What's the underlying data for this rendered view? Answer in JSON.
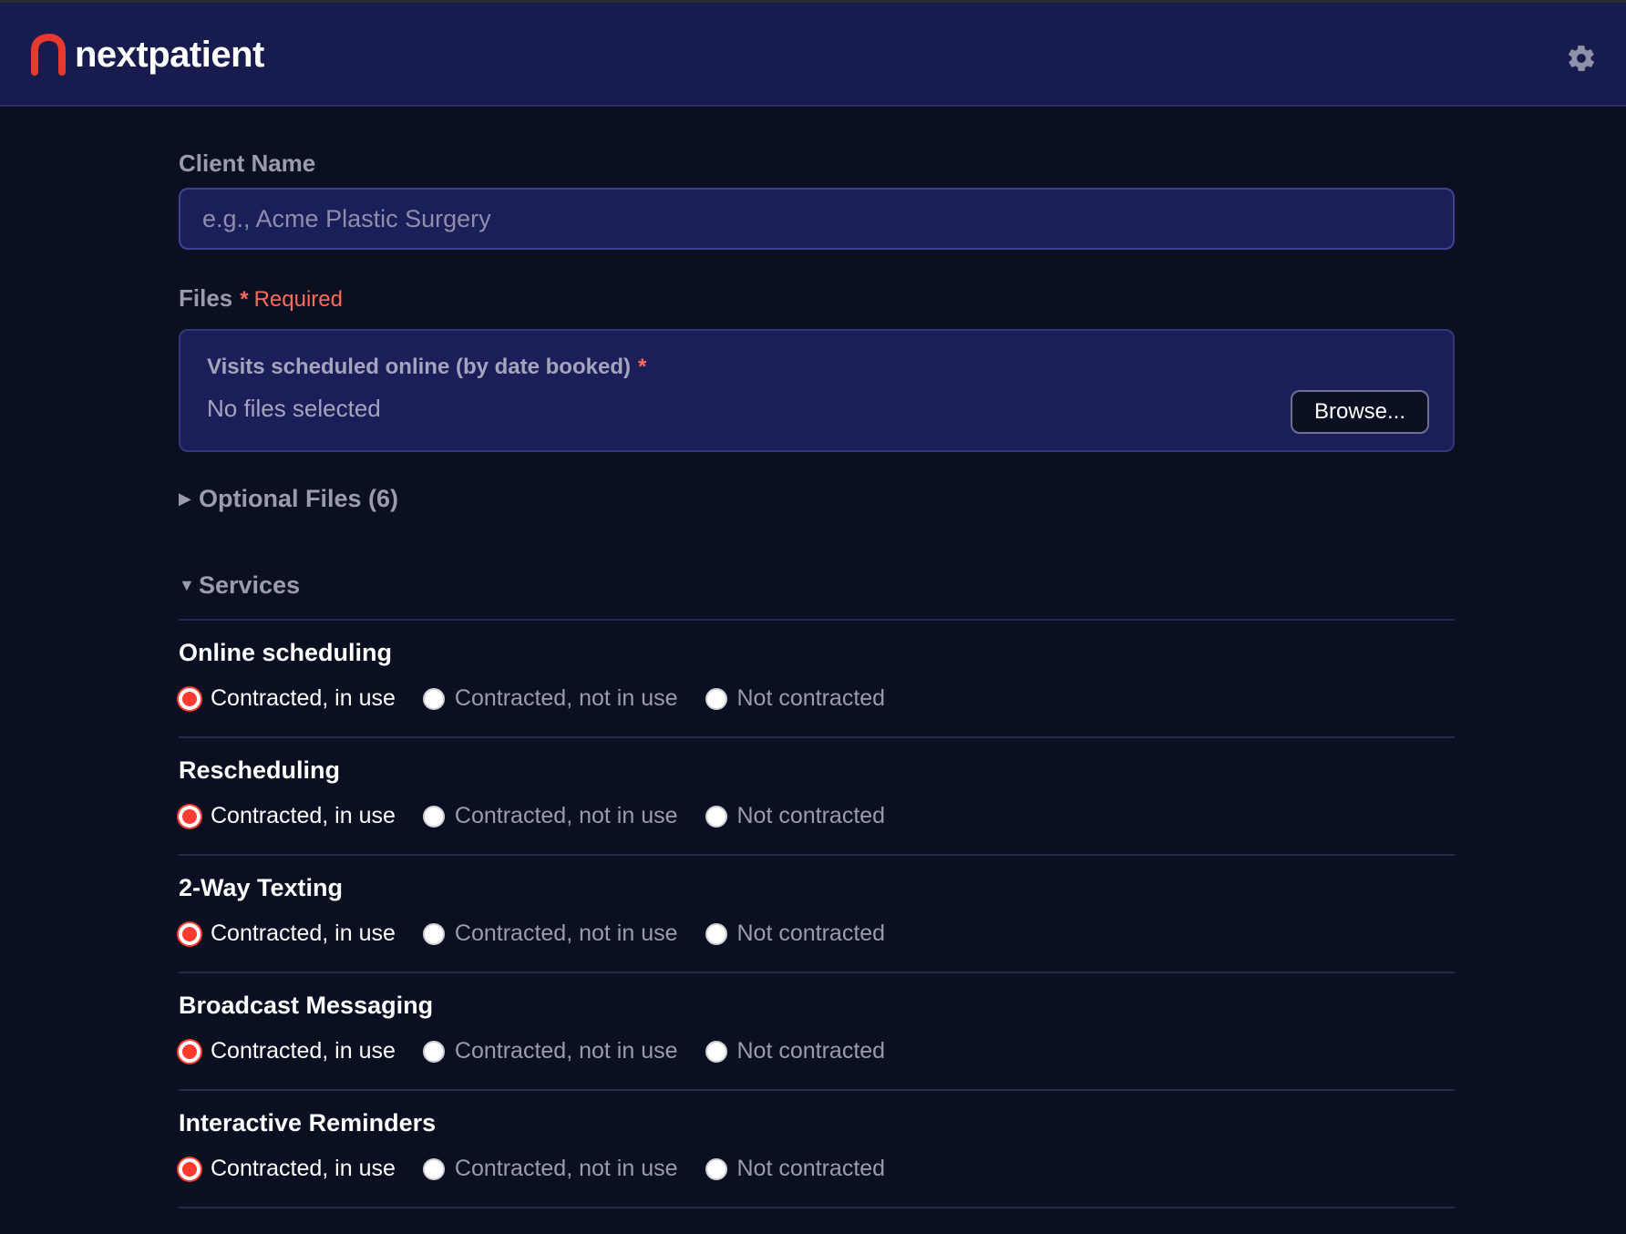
{
  "header": {
    "brand": "nextpatient",
    "settings_icon": "gear-icon",
    "brand_color": "#e8392f"
  },
  "form": {
    "client_name_label": "Client Name",
    "client_name_placeholder": "e.g., Acme Plastic Surgery",
    "client_name_value": "",
    "files_label": "Files",
    "files_required_star": "*",
    "files_required_text": "Required",
    "file_slot_title": "Visits scheduled online (by date booked)",
    "file_slot_star": "*",
    "file_slot_status": "No files selected",
    "browse_label": "Browse...",
    "optional_files_caret": "▶",
    "optional_files_label": "Optional Files (6)",
    "services_caret": "▼",
    "services_label": "Services"
  },
  "services": [
    {
      "name": "Online scheduling",
      "options": [
        "Contracted, in use",
        "Contracted, not in use",
        "Not contracted"
      ],
      "selected": "Contracted, in use"
    },
    {
      "name": "Rescheduling",
      "options": [
        "Contracted, in use",
        "Contracted, not in use",
        "Not contracted"
      ],
      "selected": "Contracted, in use"
    },
    {
      "name": "2-Way Texting",
      "options": [
        "Contracted, in use",
        "Contracted, not in use",
        "Not contracted"
      ],
      "selected": "Contracted, in use"
    },
    {
      "name": "Broadcast Messaging",
      "options": [
        "Contracted, in use",
        "Contracted, not in use",
        "Not contracted"
      ],
      "selected": "Contracted, in use"
    },
    {
      "name": "Interactive Reminders",
      "options": [
        "Contracted, in use",
        "Contracted, not in use",
        "Not contracted"
      ],
      "selected": "Contracted, in use"
    }
  ],
  "colors": {
    "accent": "#ff3b30",
    "header_bg": "#181b4d",
    "page_bg": "#0b0f22",
    "input_bg": "#1b1e58"
  }
}
